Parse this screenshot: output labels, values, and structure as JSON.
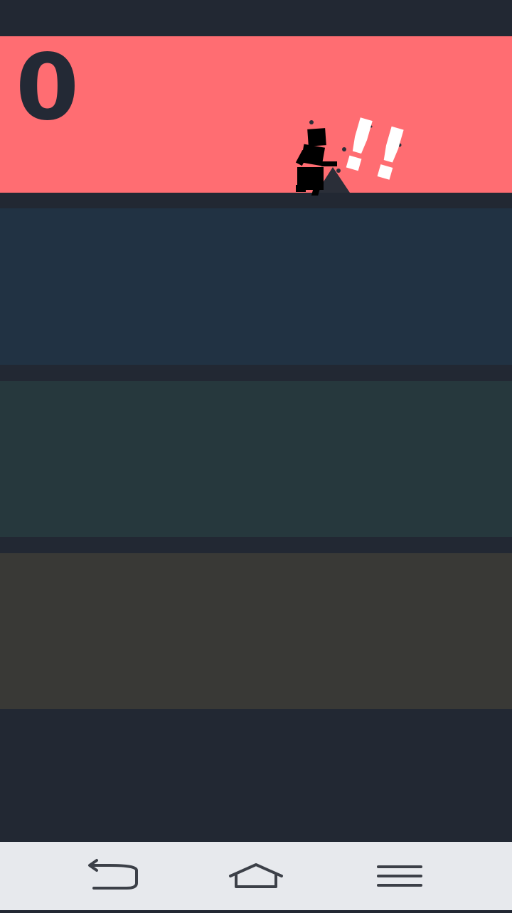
{
  "game": {
    "score": "0",
    "lanes": [
      {
        "color": "#ff6d72",
        "active": true
      },
      {
        "color": "#213243",
        "active": false
      },
      {
        "color": "#26383d",
        "active": false
      },
      {
        "color": "#393936",
        "active": false
      }
    ],
    "background_color": "#222833",
    "alert_glyph": "!!",
    "alert_color": "#ffffff"
  },
  "navbar": {
    "icons": [
      "back-arrow-icon",
      "home-icon",
      "menu-icon"
    ],
    "background_color": "#e7e9ed",
    "icon_color": "#3c4048"
  }
}
